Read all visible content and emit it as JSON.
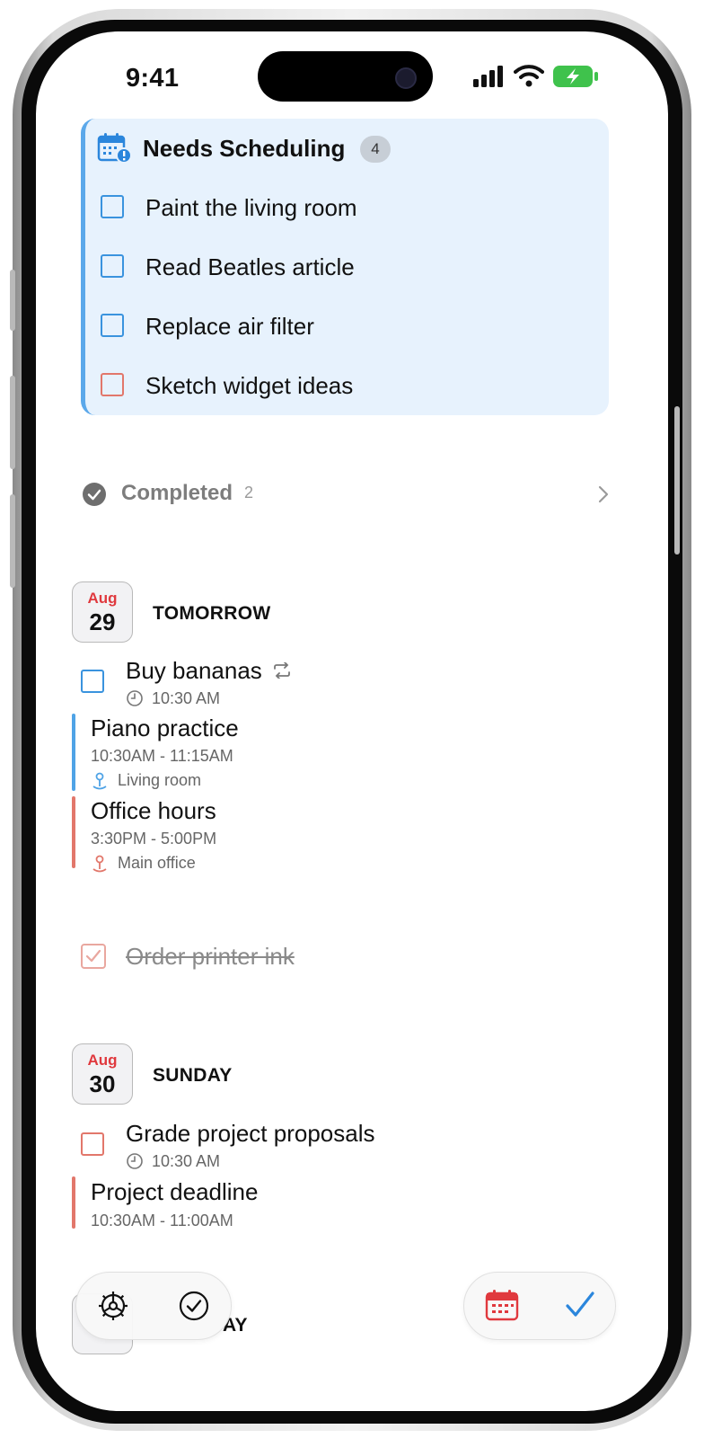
{
  "status_bar": {
    "time": "9:41"
  },
  "needs_scheduling": {
    "title": "Needs Scheduling",
    "count": "4",
    "items": [
      {
        "label": "Paint the living room",
        "color": "#3a93de"
      },
      {
        "label": "Read Beatles article",
        "color": "#3a93de"
      },
      {
        "label": "Replace air filter",
        "color": "#3a93de"
      },
      {
        "label": "Sketch widget ideas",
        "color": "#e2776b"
      }
    ]
  },
  "completed": {
    "label": "Completed",
    "count": "2"
  },
  "tomorrow": {
    "month": "Aug",
    "day": "29",
    "label": "TOMORROW",
    "tasks": [
      {
        "title": "Buy bananas",
        "time": "10:30 AM",
        "repeat_icon": "repeat-icon",
        "clock_icon": "clock-icon"
      }
    ],
    "events": [
      {
        "title": "Piano practice",
        "time": "10:30AM - 11:15AM",
        "location": "Living room",
        "color": "#4fa3e6"
      },
      {
        "title": "Office hours",
        "time": "3:30PM - 5:00PM",
        "location": "Main office",
        "color": "#e2776b"
      }
    ],
    "done_task": {
      "title": "Order printer ink"
    }
  },
  "sunday": {
    "month": "Aug",
    "day": "30",
    "label": "SUNDAY",
    "task": {
      "title": "Grade project proposals",
      "time": "10:30 AM"
    },
    "event": {
      "title": "Project deadline",
      "time": "10:30AM - 11:00AM",
      "color": "#e2776b"
    }
  },
  "monday_partial": {
    "label": "AY"
  },
  "toolbar": {
    "left_icons": [
      "settings-icon",
      "completed-check-icon"
    ],
    "right_icons": [
      "calendar-icon",
      "checkmark-icon"
    ]
  },
  "colors": {
    "accent_blue": "#3a93de",
    "accent_red": "#e2776b",
    "card_bg": "#e7f2fd"
  }
}
